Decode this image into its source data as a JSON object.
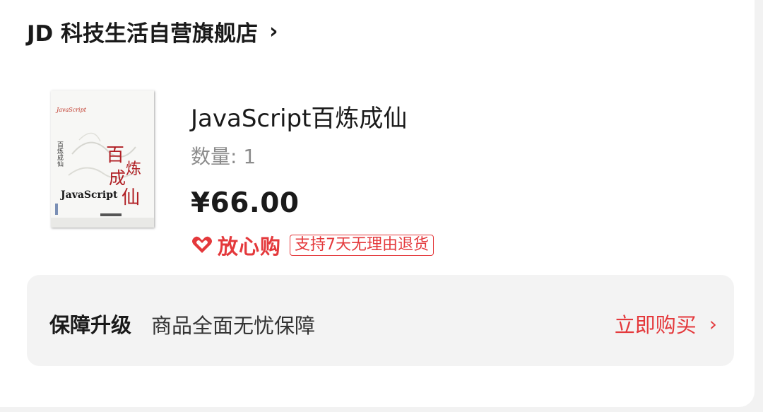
{
  "shop": {
    "name": "JD 科技生活自营旗舰店",
    "chevron": "›"
  },
  "product": {
    "title": "JavaScript百炼成仙",
    "quantity": "数量: 1",
    "price": "¥66.00",
    "cover": {
      "title_latin": "JavaScript",
      "title_cn": "百炼成仙",
      "chars": [
        "百",
        "炼",
        "成",
        "仙"
      ]
    }
  },
  "assurance": {
    "icon": "heart-icon",
    "name": "放心购",
    "tag": "支持7天无理由退货"
  },
  "upgrade": {
    "label": "保障升级",
    "description": "商品全面无忧保障",
    "buy_label": "立即购买",
    "chevron": "›"
  },
  "colors": {
    "accent": "#e4393c",
    "card": "#ffffff",
    "panel": "#f3f3f3",
    "background": "#f2f2f2"
  }
}
